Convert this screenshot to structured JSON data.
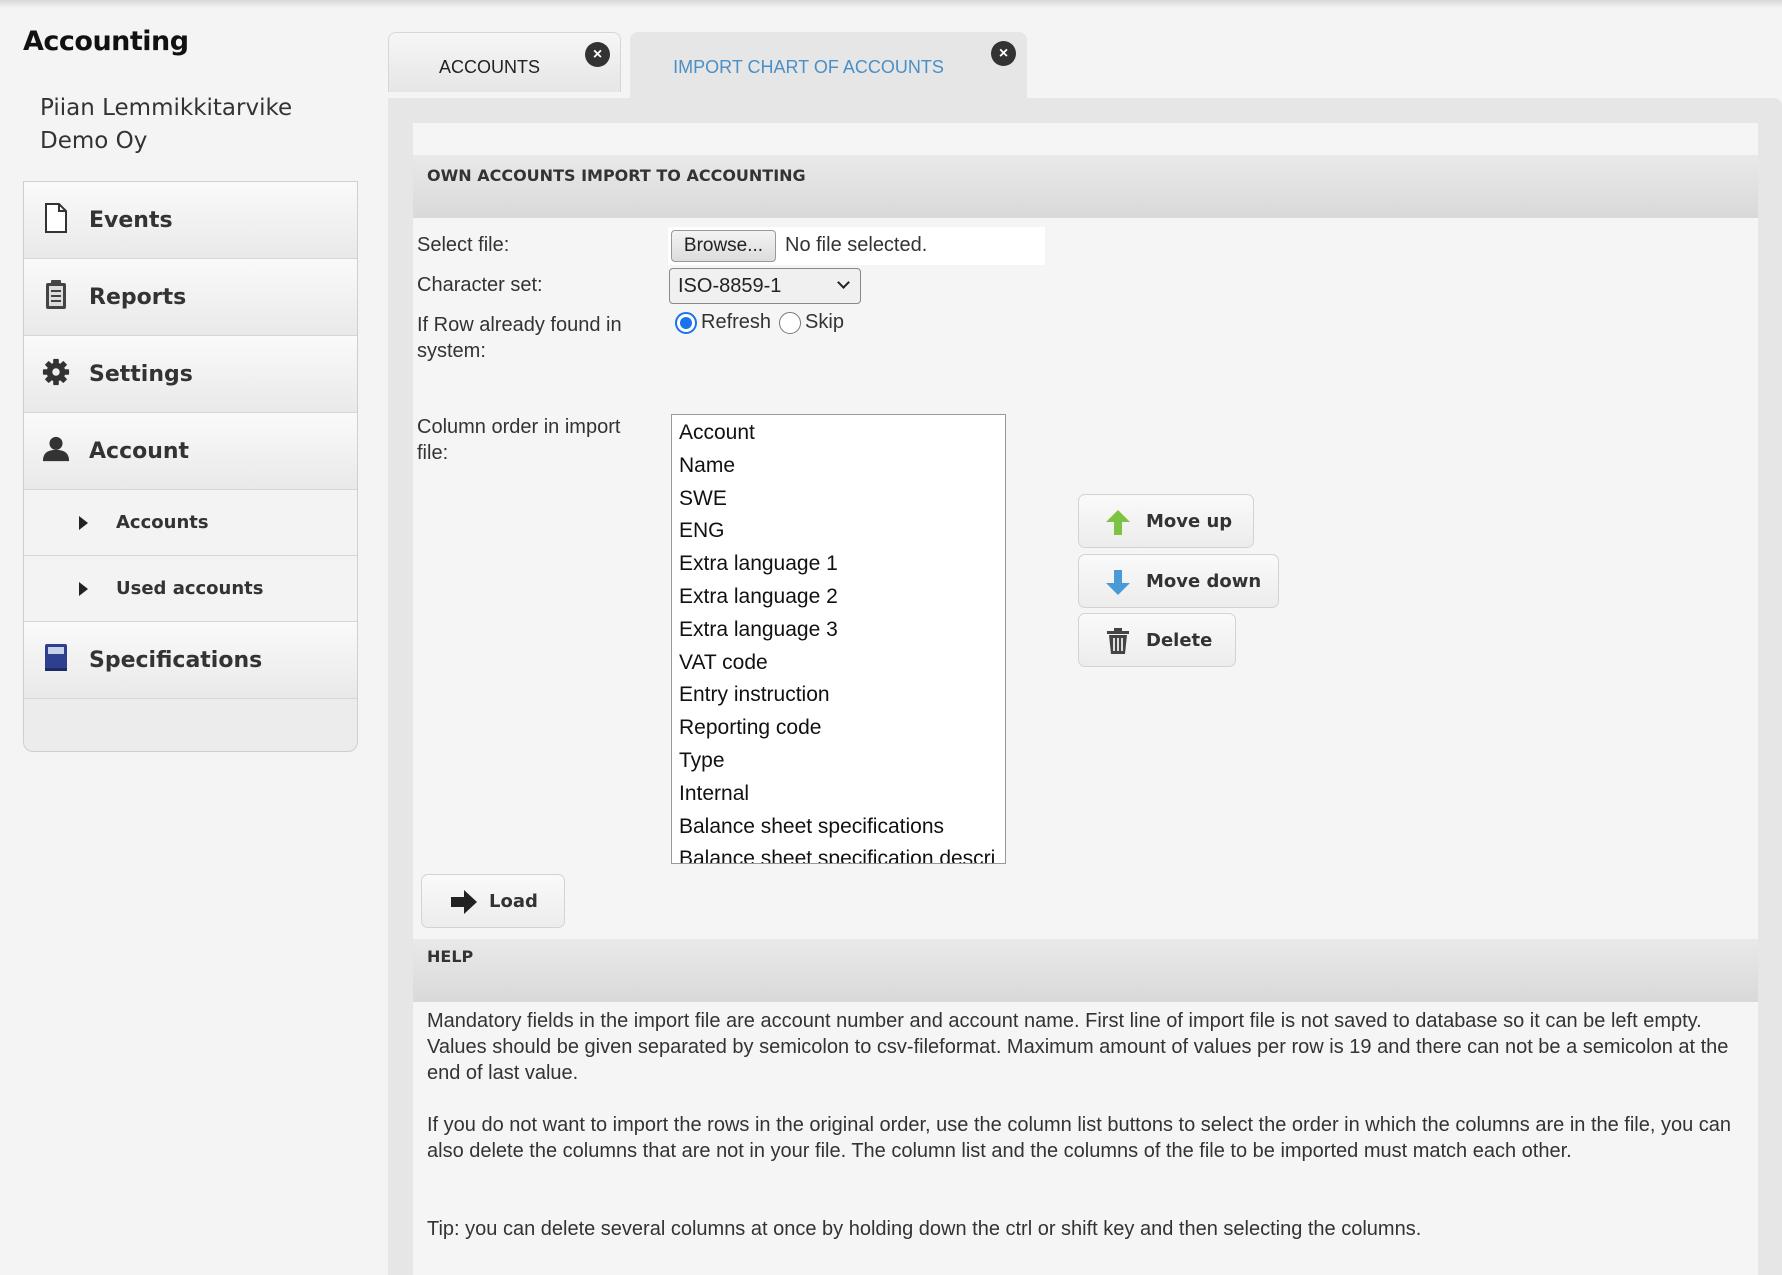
{
  "app": {
    "title": "Accounting",
    "company": "Piian Lemmikkitarvike Demo Oy"
  },
  "sidebar": {
    "items": [
      {
        "label": "Events",
        "icon": "document-icon"
      },
      {
        "label": "Reports",
        "icon": "report-icon"
      },
      {
        "label": "Settings",
        "icon": "gear-icon"
      },
      {
        "label": "Account",
        "icon": "user-icon"
      },
      {
        "label": "Specifications",
        "icon": "book-icon"
      }
    ],
    "sub_items": [
      {
        "label": "Accounts"
      },
      {
        "label": "Used accounts"
      }
    ]
  },
  "tabs": [
    {
      "label": "ACCOUNTS",
      "active": false
    },
    {
      "label": "IMPORT CHART OF ACCOUNTS",
      "active": true
    }
  ],
  "import_section": {
    "title": "OWN ACCOUNTS IMPORT TO ACCOUNTING",
    "select_file_label": "Select file:",
    "browse_label": "Browse...",
    "file_status": "No file selected.",
    "charset_label": "Character set:",
    "charset_value": "ISO-8859-1",
    "row_found_label": "If Row already found in system:",
    "radio_refresh": "Refresh",
    "radio_skip": "Skip",
    "radio_selected": "Refresh",
    "column_order_label": "Column order in import file:",
    "columns": [
      "Account",
      "Name",
      "SWE",
      "ENG",
      "Extra language 1",
      "Extra language 2",
      "Extra language 3",
      "VAT code",
      "Entry instruction",
      "Reporting code",
      "Type",
      "Internal",
      "Balance sheet specifications",
      "Balance sheet specification descri"
    ],
    "move_up_label": "Move up",
    "move_down_label": "Move down",
    "delete_label": "Delete",
    "load_label": "Load"
  },
  "help": {
    "title": "HELP",
    "paragraphs": [
      "Mandatory fields in the import file are account number and account name. First line of import file is not saved to database so it can be left empty. Values should be given separated by semicolon to csv-fileformat. Maximum amount of values per row is 19 and there can not be a semicolon at the end of last value.",
      "If you do not want to import the rows in the original order, use the column list buttons to select the order in which the columns are in the file, you can also delete the columns that are not in your file. The column list and the columns of the file to be imported must match each other.",
      "Tip: you can delete several columns at once by holding down the ctrl or shift key and then selecting the columns."
    ]
  },
  "colors": {
    "active_tab_text": "#4a8fc7",
    "radio_accent": "#1a73e8",
    "arrow_up": "#7cc243",
    "arrow_down": "#4a9ad8",
    "spec_icon": "#2e3f8f"
  }
}
